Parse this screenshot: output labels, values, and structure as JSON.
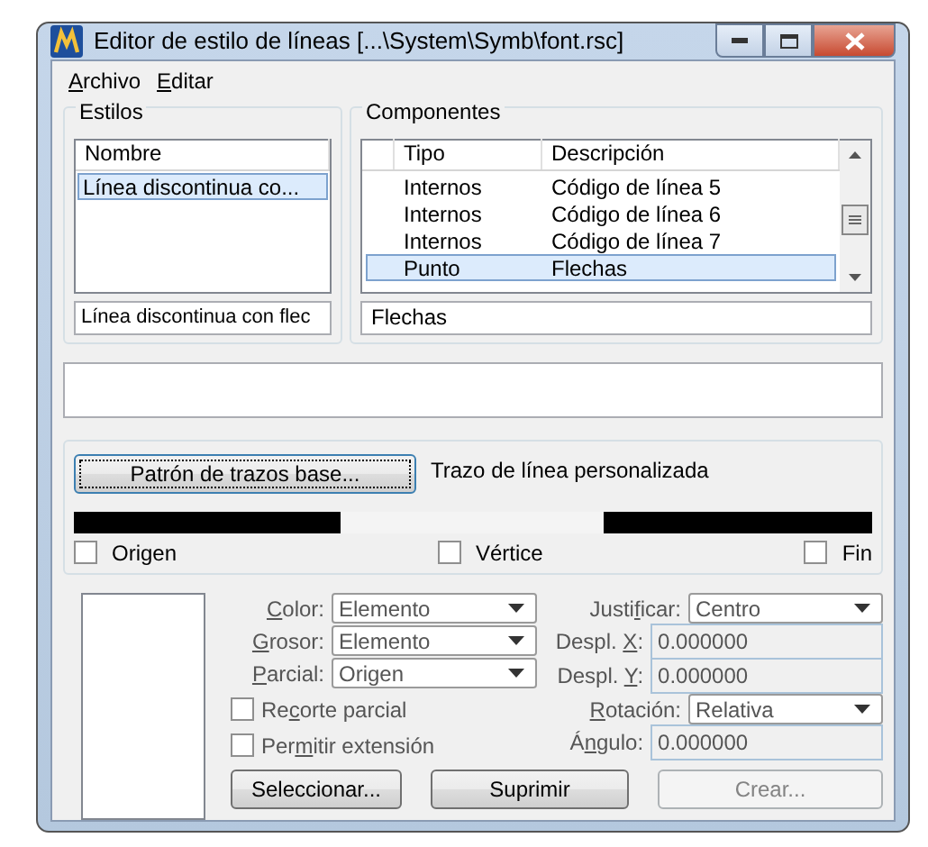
{
  "window": {
    "title": "Editor de estilo de líneas [...\\System\\Symb\\font.rsc]"
  },
  "menu": [
    {
      "key": "A",
      "post": "rchivo"
    },
    {
      "key": "E",
      "post": "ditar"
    }
  ],
  "estilos": {
    "title": "Estilos",
    "column": "Nombre",
    "items": [
      {
        "text": "Línea discontinua co...",
        "selected": true
      }
    ],
    "name_field": "Línea discontinua con flec"
  },
  "componentes": {
    "title": "Componentes",
    "columns": [
      "Tipo",
      "Descripción"
    ],
    "rows": [
      {
        "tipo": "Internos",
        "descripcion": "Código de línea 5",
        "selected": false
      },
      {
        "tipo": "Internos",
        "descripcion": "Código de línea 6",
        "selected": false
      },
      {
        "tipo": "Internos",
        "descripcion": "Código de línea 7",
        "selected": false
      },
      {
        "tipo": "Punto",
        "descripcion": "Flechas",
        "selected": true
      }
    ],
    "description_field": "Flechas"
  },
  "stroke": {
    "button": {
      "label": "Patrón de trazos base...",
      "focused": true
    },
    "caption": "Trazo de línea personalizada",
    "checkboxes": [
      {
        "label": "Origen",
        "checked": false
      },
      {
        "label": "Vértice",
        "checked": false
      },
      {
        "label": "Fin",
        "checked": false
      }
    ]
  },
  "left_form": [
    {
      "kind": "select",
      "label": {
        "key": "C",
        "post": "olor:"
      },
      "value": "Elemento"
    },
    {
      "kind": "select",
      "label": {
        "key": "G",
        "post": "rosor:"
      },
      "value": "Elemento"
    },
    {
      "kind": "select",
      "label": {
        "key": "P",
        "post": "arcial:"
      },
      "value": "Origen"
    },
    {
      "kind": "checkbox",
      "label": {
        "pre": "Re",
        "key": "c",
        "post": "orte parcial"
      },
      "checked": false
    },
    {
      "kind": "checkbox",
      "label": {
        "pre": "Per",
        "key": "m",
        "post": "itir extensión"
      },
      "checked": false
    }
  ],
  "right_form": [
    {
      "kind": "select",
      "label": {
        "pre": "Justi",
        "key": "f",
        "post": "icar:"
      },
      "value": "Centro"
    },
    {
      "kind": "field",
      "label": {
        "pre": "Despl. ",
        "key": "X",
        "post": ":"
      },
      "value": "0.000000"
    },
    {
      "kind": "field",
      "label": {
        "pre": "Despl. ",
        "key": "Y",
        "post": ":"
      },
      "value": "0.000000"
    },
    {
      "kind": "select",
      "label": {
        "key": "R",
        "post": "otación:"
      },
      "value": "Relativa"
    },
    {
      "kind": "field",
      "label": {
        "pre": "Á",
        "key": "n",
        "post": "gulo:"
      },
      "value": "0.000000"
    }
  ],
  "buttons": [
    {
      "label": "Seleccionar...",
      "disabled": false
    },
    {
      "label": "Suprimir",
      "disabled": false
    },
    {
      "label": "Crear...",
      "disabled": true
    }
  ]
}
